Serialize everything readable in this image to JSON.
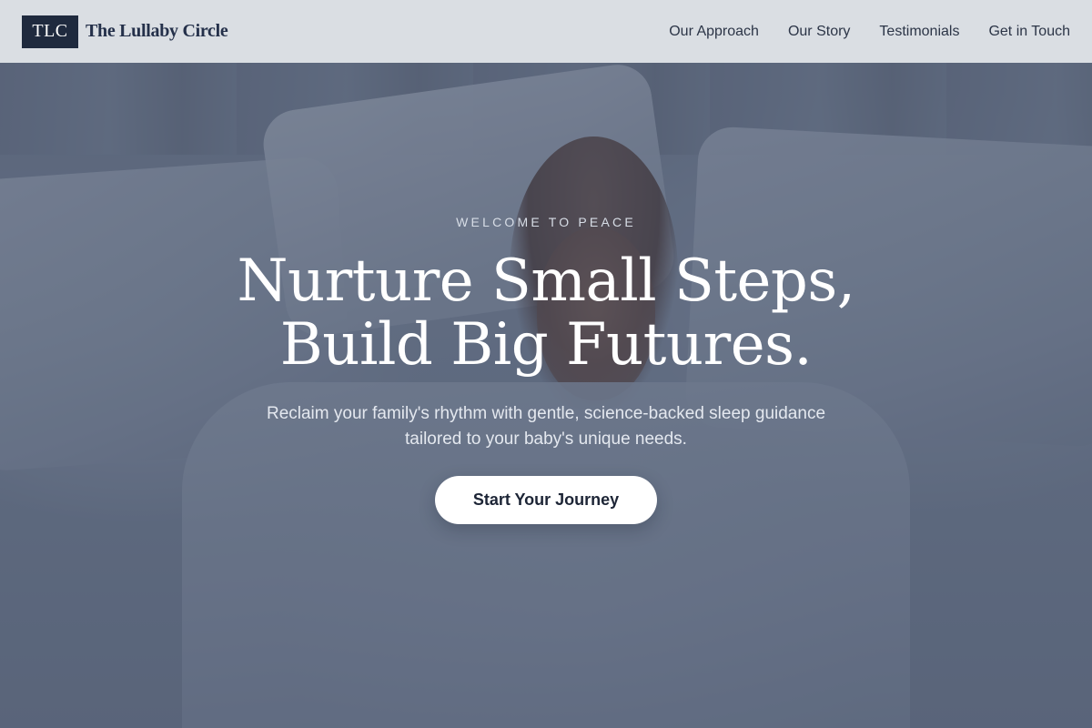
{
  "header": {
    "logo_text": "TLC",
    "brand_name": "The Lullaby Circle",
    "nav": [
      {
        "label": "Our Approach"
      },
      {
        "label": "Our Story"
      },
      {
        "label": "Testimonials"
      },
      {
        "label": "Get in Touch"
      }
    ]
  },
  "hero": {
    "eyebrow": "WELCOME TO PEACE",
    "headline_line1": "Nurture Small Steps,",
    "headline_line2": "Build Big Futures.",
    "subtext": "Reclaim your family's rhythm with gentle, science-backed sleep guidance tailored to your baby's unique needs.",
    "cta_label": "Start Your Journey",
    "background_image": "sleeping-child-in-bed-photo"
  },
  "colors": {
    "brand_dark": "#1f2a3e",
    "navbar_bg": "#e2e6ea",
    "overlay": "#37445c",
    "cta_bg": "#ffffff"
  }
}
